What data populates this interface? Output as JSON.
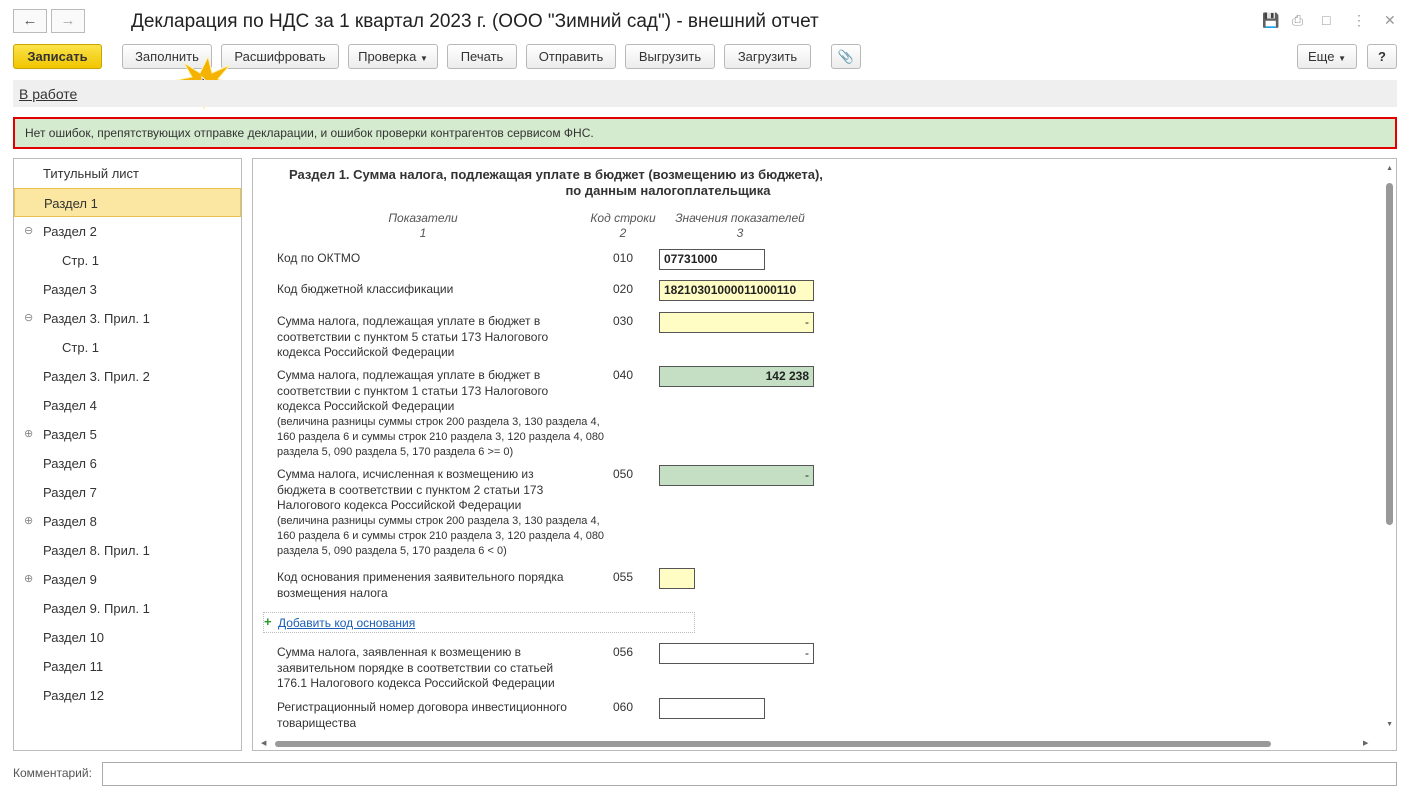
{
  "window": {
    "title": "Декларация по НДС за 1 квартал 2023 г. (ООО \"Зимний сад\") - внешний отчет"
  },
  "toolbar": {
    "save": "Записать",
    "fill": "Заполнить",
    "decode": "Расшифровать",
    "check": "Проверка",
    "print": "Печать",
    "send": "Отправить",
    "export": "Выгрузить",
    "import": "Загрузить",
    "more": "Еще",
    "help": "?"
  },
  "status": {
    "link": "В работе"
  },
  "message": "Нет ошибок, препятствующих отправке декларации, и ошибок проверки контрагентов сервисом ФНС.",
  "tree": [
    {
      "label": "Титульный лист"
    },
    {
      "label": "Раздел 1"
    },
    {
      "label": "Раздел 2",
      "toggle": "⊖"
    },
    {
      "label": "Стр. 1"
    },
    {
      "label": "Раздел 3"
    },
    {
      "label": "Раздел 3. Прил. 1",
      "toggle": "⊖"
    },
    {
      "label": "Стр. 1"
    },
    {
      "label": "Раздел 3. Прил. 2"
    },
    {
      "label": "Раздел 4"
    },
    {
      "label": "Раздел 5",
      "toggle": "⊕"
    },
    {
      "label": "Раздел 6"
    },
    {
      "label": "Раздел 7"
    },
    {
      "label": "Раздел 8",
      "toggle": "⊕"
    },
    {
      "label": "Раздел 8. Прил. 1"
    },
    {
      "label": "Раздел 9",
      "toggle": "⊕"
    },
    {
      "label": "Раздел 9. Прил. 1"
    },
    {
      "label": "Раздел 10"
    },
    {
      "label": "Раздел 11"
    },
    {
      "label": "Раздел 12"
    }
  ],
  "form": {
    "heading1": "Раздел 1. Сумма налога, подлежащая уплате в бюджет (возмещению из бюджета),",
    "heading2": "по данным налогоплательщика",
    "col1": "Показатели",
    "col1n": "1",
    "col2": "Код строки",
    "col2n": "2",
    "col3": "Значения показателей",
    "col3n": "3",
    "rows": [
      {
        "label": "Код по ОКТМО",
        "code": "010",
        "value": "07731000"
      },
      {
        "label": "Код бюджетной классификации",
        "code": "020",
        "value": "18210301000011000110"
      },
      {
        "label": "Сумма налога, подлежащая уплате в бюджет в соответствии с пунктом 5 статьи 173 Налогового кодекса Российской Федерации",
        "code": "030",
        "value": "-"
      },
      {
        "label": "Сумма налога, подлежащая уплате в бюджет в соответствии с пунктом 1 статьи 173 Налогового кодекса Российской Федерации",
        "note": "(величина разницы суммы строк 200 раздела 3, 130 раздела 4, 160 раздела 6 и суммы строк 210 раздела 3, 120 раздела 4, 080 раздела 5, 090 раздела 5, 170 раздела 6 >= 0)",
        "code": "040",
        "value": "142 238"
      },
      {
        "label": "Сумма налога, исчисленная к возмещению из бюджета в соответствии с пунктом 2 статьи 173 Налогового кодекса Российской Федерации",
        "note": "(величина разницы суммы строк 200 раздела 3, 130 раздела 4, 160 раздела 6 и суммы строк 210 раздела 3, 120 раздела 4, 080 раздела 5, 090 раздела 5, 170 раздела 6 < 0)",
        "code": "050",
        "value": "-"
      },
      {
        "label": "Код основания применения заявительного порядка возмещения налога",
        "code": "055",
        "value": ""
      },
      {
        "label": "Сумма налога, заявленная к возмещению в заявительном порядке в соответствии со статьей 176.1 Налогового кодекса Российской Федерации",
        "code": "056",
        "value": "-"
      },
      {
        "label": "Регистрационный номер договора инвестиционного товарищества",
        "code": "060",
        "value": ""
      }
    ],
    "add_link": "Добавить код основания"
  },
  "comment": {
    "label": "Комментарий:",
    "value": ""
  }
}
